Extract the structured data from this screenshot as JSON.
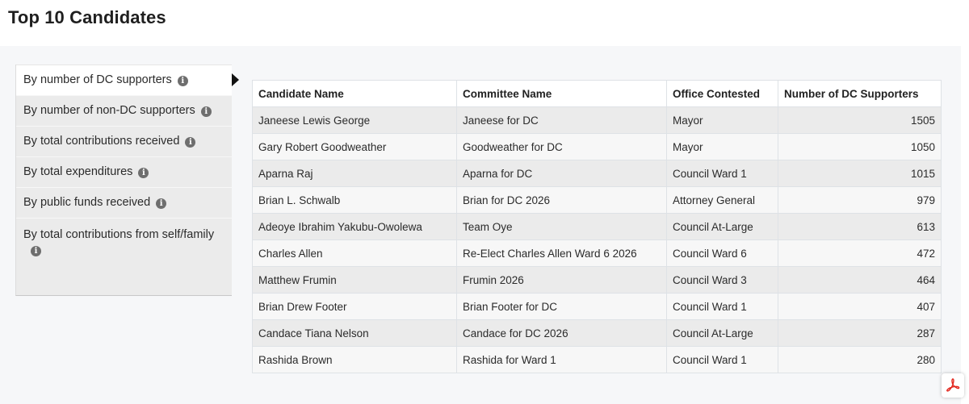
{
  "page": {
    "title": "Top 10 Candidates"
  },
  "nav": {
    "items": [
      {
        "label": "By number of DC supporters",
        "active": true
      },
      {
        "label": "By number of non-DC supporters"
      },
      {
        "label": "By total contributions received"
      },
      {
        "label": "By total expenditures"
      },
      {
        "label": "By public funds received"
      },
      {
        "label": "By total contributions from self/family"
      }
    ],
    "info_glyph": "i"
  },
  "table": {
    "headers": [
      "Candidate Name",
      "Committee Name",
      "Office Contested",
      "Number of DC Supporters"
    ],
    "rows": [
      [
        "Janeese Lewis George",
        "Janeese for DC",
        "Mayor",
        "1505"
      ],
      [
        "Gary Robert Goodweather",
        "Goodweather for DC",
        "Mayor",
        "1050"
      ],
      [
        "Aparna Raj",
        "Aparna for DC",
        "Council Ward 1",
        "1015"
      ],
      [
        "Brian L. Schwalb",
        "Brian for DC 2026",
        "Attorney General",
        "979"
      ],
      [
        "Adeoye Ibrahim Yakubu-Owolewa",
        "Team Oye",
        "Council At-Large",
        "613"
      ],
      [
        "Charles Allen",
        "Re-Elect Charles Allen Ward 6 2026",
        "Council Ward 6",
        "472"
      ],
      [
        "Matthew Frumin",
        "Frumin 2026",
        "Council Ward 3",
        "464"
      ],
      [
        "Brian Drew Footer",
        "Brian Footer for DC",
        "Council Ward 1",
        "407"
      ],
      [
        "Candace Tiana Nelson",
        "Candace for DC 2026",
        "Council At-Large",
        "287"
      ],
      [
        "Rashida Brown",
        "Rashida for Ward 1",
        "Council Ward 1",
        "280"
      ]
    ]
  },
  "icons": {
    "pdf": "pdf-icon",
    "info": "info-icon",
    "arrow": "caret-right-icon"
  },
  "colors": {
    "pdf_red": "#e2231a",
    "info_grey": "#6e6e6e"
  }
}
